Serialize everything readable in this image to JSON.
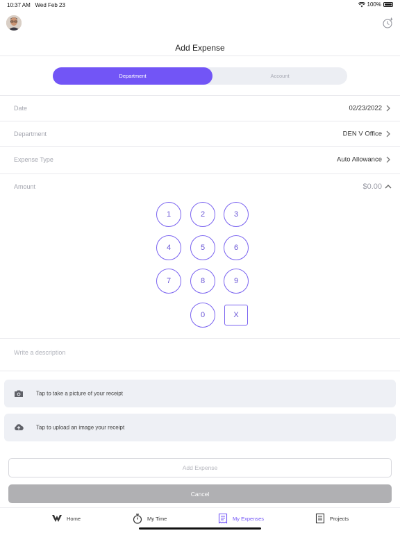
{
  "status_bar": {
    "time": "10:37 AM",
    "date": "Wed Feb 23",
    "battery": "100%"
  },
  "header": {
    "title": "Add Expense"
  },
  "segmented": {
    "department": "Department",
    "account": "Account",
    "selected": "Department"
  },
  "fields": {
    "date": {
      "label": "Date",
      "value": "02/23/2022"
    },
    "department": {
      "label": "Department",
      "value": "DEN V Office"
    },
    "expense_type": {
      "label": "Expense Type",
      "value": "Auto Allowance"
    },
    "amount": {
      "label": "Amount",
      "value": "$0.00"
    }
  },
  "keypad": {
    "keys": [
      "1",
      "2",
      "3",
      "4",
      "5",
      "6",
      "7",
      "8",
      "9",
      "0",
      "X"
    ]
  },
  "description": {
    "placeholder": "Write a description"
  },
  "receipt": {
    "photo_label": "Tap to take a picture of your receipt",
    "upload_label": "Tap to upload an image your receipt"
  },
  "actions": {
    "add": "Add Expense",
    "cancel": "Cancel"
  },
  "tabbar": {
    "items": [
      {
        "label": "Home",
        "icon": "logo-icon"
      },
      {
        "label": "My Time",
        "icon": "stopwatch-icon"
      },
      {
        "label": "My Expenses",
        "icon": "receipt-icon"
      },
      {
        "label": "Projects",
        "icon": "document-icon"
      }
    ],
    "active": "My Expenses"
  },
  "colors": {
    "accent": "#7255f6",
    "cancel": "#b0b0b3",
    "card": "#eef0f5"
  }
}
